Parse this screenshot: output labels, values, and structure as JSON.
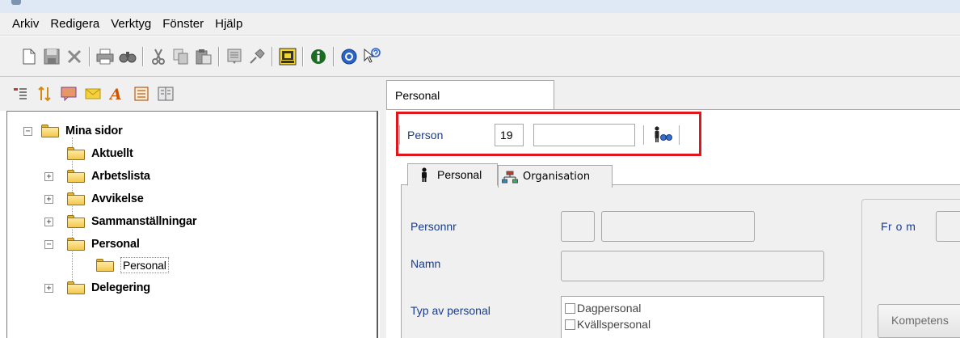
{
  "menubar": {
    "items": [
      "Arkiv",
      "Redigera",
      "Verktyg",
      "Fönster",
      "Hjälp"
    ]
  },
  "toolbar": {
    "icons": [
      "new-document-icon",
      "save-icon",
      "delete-icon",
      "print-icon",
      "find-icon",
      "cut-icon",
      "copy-icon",
      "paste-icon",
      "report-icon",
      "pin-icon",
      "export-icon",
      "info-icon",
      "help-icon",
      "whats-this-icon"
    ]
  },
  "left_toolbar": {
    "icons": [
      "menu-icon",
      "sort-icon",
      "chat-icon",
      "mail-icon",
      "font-icon",
      "notes-icon",
      "book-icon"
    ]
  },
  "tree": {
    "root": "Mina sidor",
    "items": [
      {
        "label": "Aktuellt",
        "expander": ""
      },
      {
        "label": "Arbetslista",
        "expander": "+"
      },
      {
        "label": "Avvikelse",
        "expander": "+"
      },
      {
        "label": "Sammanställningar",
        "expander": "+"
      },
      {
        "label": "Personal",
        "expander": "−"
      },
      {
        "label": "Delegering",
        "expander": "+"
      }
    ],
    "child": "Personal"
  },
  "main_tab": {
    "label": "Personal"
  },
  "person_bar": {
    "label": "Person",
    "number": "19",
    "name": ""
  },
  "sub_tabs": {
    "personal": "Personal",
    "organisation": "Organisation"
  },
  "form": {
    "personnr_label": "Personnr",
    "namn_label": "Namn",
    "typ_label": "Typ av personal",
    "typ_options": [
      "Dagpersonal",
      "Kvällspersonal"
    ],
    "from_label": "Fr o m",
    "kompetens_button": "Kompetens"
  },
  "colors": {
    "highlight": "#e0161b",
    "label_blue": "#1a3a8a",
    "panel_bg": "#f0f0f0"
  }
}
